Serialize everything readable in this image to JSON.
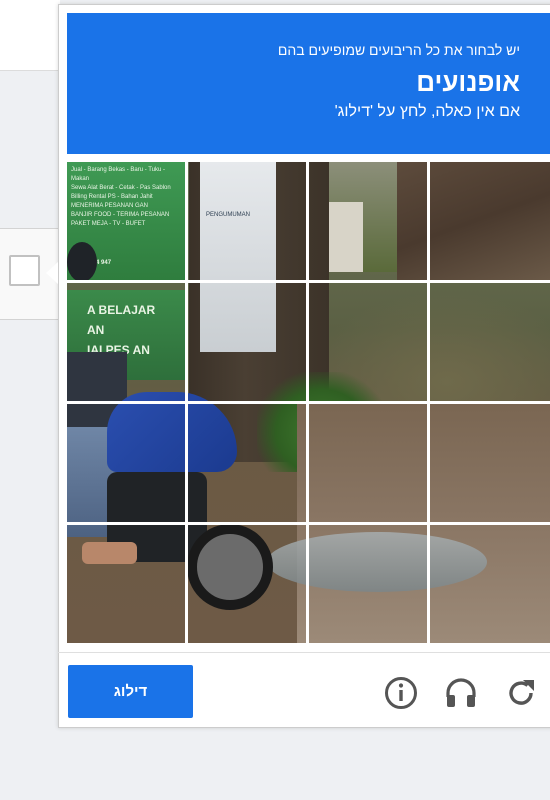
{
  "challenge": {
    "instruction_line": "יש לבחור את כל הריבועים שמופיעים בהם",
    "target_object": "אופנועים",
    "skip_hint": "אם אין כאלה, לחץ על 'דילוג'"
  },
  "image": {
    "sign_lines": [
      "Jual - Barang Bekas - Baru - Tuku - Makan",
      "Sewa Alat Berat - Cetak - Pas Sablon",
      "Billing Rental PS - Bahan Jahit",
      "MENERIMA PESANAN GAN",
      "BANJIR FOOD - TERIMA PESANAN",
      "PAKET MEJA - TV - BUFET",
      "0834 9414 947"
    ],
    "banner_lines": [
      "A BELAJAR",
      "AN",
      "IAI PES AN"
    ],
    "poster_caption": "PENGUMUMAN"
  },
  "footer": {
    "skip_label": "דילוג",
    "icons": [
      "info-icon",
      "headphones-icon",
      "reload-icon"
    ]
  },
  "colors": {
    "header_blue": "#1a73e8",
    "button_blue": "#1a73e8",
    "icon_gray": "#555555"
  }
}
